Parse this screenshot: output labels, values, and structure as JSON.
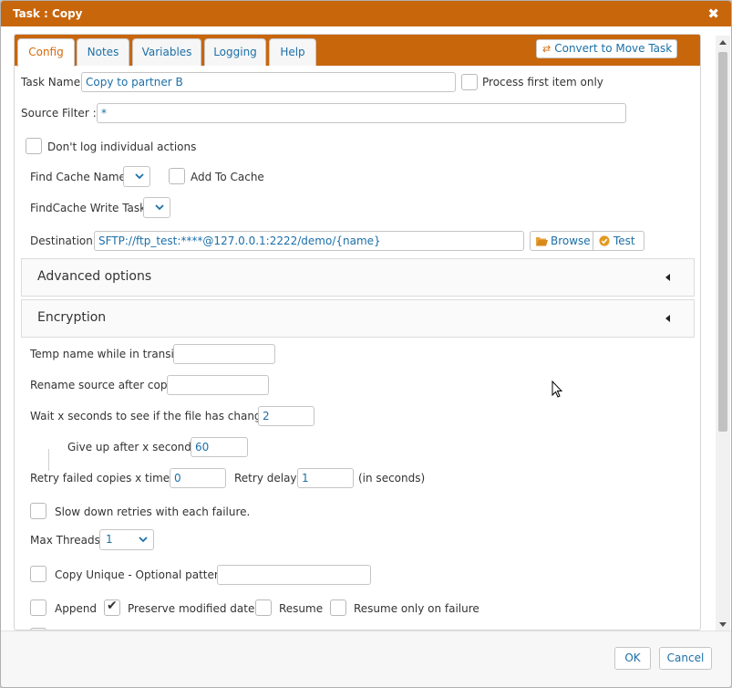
{
  "window": {
    "title": "Task : Copy",
    "close_glyph": "✖"
  },
  "tabs": [
    {
      "label": "Config",
      "active": true
    },
    {
      "label": "Notes",
      "active": false
    },
    {
      "label": "Variables",
      "active": false
    },
    {
      "label": "Logging",
      "active": false
    },
    {
      "label": "Help",
      "active": false
    }
  ],
  "convert_button": {
    "label": "Convert to Move Task",
    "icon": "arrows-exchange-icon"
  },
  "form": {
    "task_name": {
      "label": "Task Name:",
      "value": "Copy to partner B"
    },
    "process_first": {
      "label": "Process first item only",
      "checked": false
    },
    "source_filter": {
      "label": "Source Filter :",
      "value": "*"
    },
    "dont_log": {
      "label": "Don't log individual actions",
      "checked": false
    },
    "find_cache": {
      "label": "Find Cache Name:",
      "value": ""
    },
    "add_to_cache": {
      "label": "Add To Cache",
      "checked": false
    },
    "findcache_write": {
      "label": "FindCache Write Task:",
      "value": ""
    },
    "destination": {
      "label": "Destination:",
      "value": "SFTP://ftp_test:****@127.0.0.1:2222/demo/{name}"
    },
    "browse_button": {
      "label": "Browse",
      "icon": "folder-open-icon"
    },
    "test_button": {
      "label": "Test",
      "icon": "check-circle-icon"
    },
    "temp_name": {
      "label": "Temp name while in transit:",
      "value": ""
    },
    "rename_source": {
      "label": "Rename source after copy:",
      "value": ""
    },
    "wait_seconds": {
      "label": "Wait x seconds to see if the file has changed:",
      "value": "2"
    },
    "give_up": {
      "label": "Give up after x seconds:",
      "value": "60"
    },
    "retry_failed": {
      "label": "Retry failed copies x times:",
      "value": "0"
    },
    "retry_delay": {
      "label": "Retry delay:",
      "value": "1",
      "suffix": "(in seconds)"
    },
    "slow_down": {
      "label": "Slow down retries with each failure.",
      "checked": false
    },
    "max_threads": {
      "label": "Max Threads:",
      "value": "1"
    },
    "copy_unique": {
      "label": "Copy Unique - Optional pattern:",
      "checked": false,
      "value": ""
    },
    "append": {
      "label": "Append",
      "checked": false
    },
    "preserve_modified": {
      "label": "Preserve modified date",
      "checked": true
    },
    "resume": {
      "label": "Resume",
      "checked": false
    },
    "resume_on_failure": {
      "label": "Resume only on failure",
      "checked": false
    }
  },
  "panels": {
    "advanced": {
      "title": "Advanced options",
      "expanded": false
    },
    "encryption": {
      "title": "Encryption",
      "expanded": false
    }
  },
  "footer": {
    "ok_label": "OK",
    "cancel_label": "Cancel"
  },
  "colors": {
    "accent": "#c8660c",
    "link": "#1b6fa8",
    "active_tab_text": "#d26b0e"
  }
}
